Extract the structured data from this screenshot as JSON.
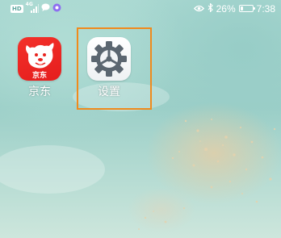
{
  "status_bar": {
    "hd_label": "HD",
    "network_label": "4G",
    "battery_percent": "26%",
    "battery_level": 0.26,
    "time": "7:38",
    "icons": [
      "hd-icon",
      "signal-icon",
      "chat-icon",
      "app-notification-icon",
      "eye-icon",
      "bluetooth-icon",
      "battery-icon"
    ]
  },
  "home_screen": {
    "apps": [
      {
        "label": "京东",
        "icon": "jd-dog-icon",
        "color": "#e8231f"
      },
      {
        "label": "设置",
        "icon": "gear-icon",
        "color": "#5b6670"
      }
    ]
  },
  "highlight": {
    "color": "#f08a1c"
  }
}
